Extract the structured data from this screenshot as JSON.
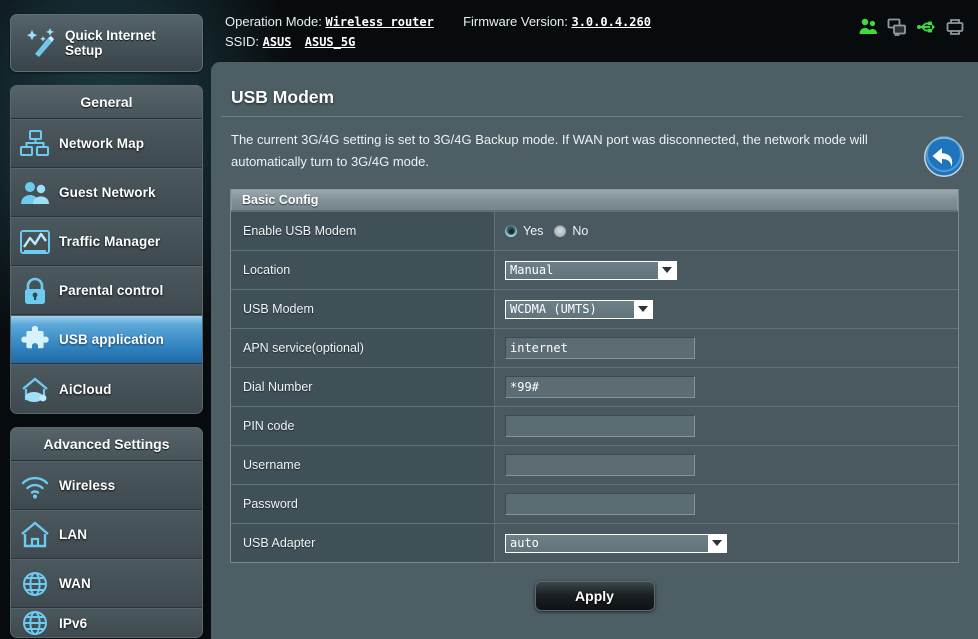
{
  "topbar": {
    "operation_mode_label": "Operation Mode:",
    "operation_mode_value": "Wireless router",
    "firmware_label": "Firmware Version:",
    "firmware_value": "3.0.0.4.260",
    "ssid_label": "SSID:",
    "ssid_value_1": "ASUS",
    "ssid_value_2": "ASUS_5G",
    "status_icons": [
      {
        "name": "users-icon",
        "color": "#3ddc3d"
      },
      {
        "name": "monitors-icon",
        "color": "#8f9a9e"
      },
      {
        "name": "usb-icon",
        "color": "#3ddc3d"
      },
      {
        "name": "printer-icon",
        "color": "#8f9a9e"
      }
    ]
  },
  "sidebar": {
    "quick_setup_label": "Quick Internet\nSetup",
    "groups": [
      {
        "title": "General",
        "items": [
          {
            "label": "Network Map",
            "icon": "network-map-icon",
            "active": false
          },
          {
            "label": "Guest Network",
            "icon": "guest-network-icon",
            "active": false
          },
          {
            "label": "Traffic Manager",
            "icon": "traffic-manager-icon",
            "active": false
          },
          {
            "label": "Parental control",
            "icon": "parental-control-icon",
            "active": false
          },
          {
            "label": "USB application",
            "icon": "usb-application-icon",
            "active": true
          },
          {
            "label": "AiCloud",
            "icon": "aicloud-icon",
            "active": false
          }
        ]
      },
      {
        "title": "Advanced Settings",
        "items": [
          {
            "label": "Wireless",
            "icon": "wireless-icon",
            "active": false
          },
          {
            "label": "LAN",
            "icon": "lan-icon",
            "active": false
          },
          {
            "label": "WAN",
            "icon": "wan-icon",
            "active": false
          },
          {
            "label": "IPv6",
            "icon": "ipv6-icon",
            "active": false
          }
        ]
      }
    ]
  },
  "main": {
    "title": "USB Modem",
    "description": "The current 3G/4G setting is set to 3G/4G Backup mode. If WAN port was disconnected, the network mode will automatically turn to 3G/4G mode.",
    "back_button": "back-icon",
    "panel_title": "Basic Config",
    "fields": {
      "enable_usb_modem": {
        "label": "Enable USB Modem",
        "yes_label": "Yes",
        "no_label": "No",
        "selected": "Yes"
      },
      "location": {
        "label": "Location",
        "value": "Manual"
      },
      "usb_modem": {
        "label": "USB Modem",
        "value": "WCDMA (UMTS)"
      },
      "apn_service": {
        "label": "APN service(optional)",
        "value": "internet"
      },
      "dial_number": {
        "label": "Dial Number",
        "value": "*99#"
      },
      "pin_code": {
        "label": "PIN code",
        "value": ""
      },
      "username": {
        "label": "Username",
        "value": ""
      },
      "password": {
        "label": "Password",
        "value": ""
      },
      "usb_adapter": {
        "label": "USB Adapter",
        "value": "auto"
      }
    },
    "apply_label": "Apply"
  },
  "colors": {
    "panel_bg": "#4d5e64",
    "accent_blue": "#2d7fbc",
    "status_green": "#3ddc3d",
    "label_col": "#3f5056",
    "value_col": "#49595f"
  }
}
